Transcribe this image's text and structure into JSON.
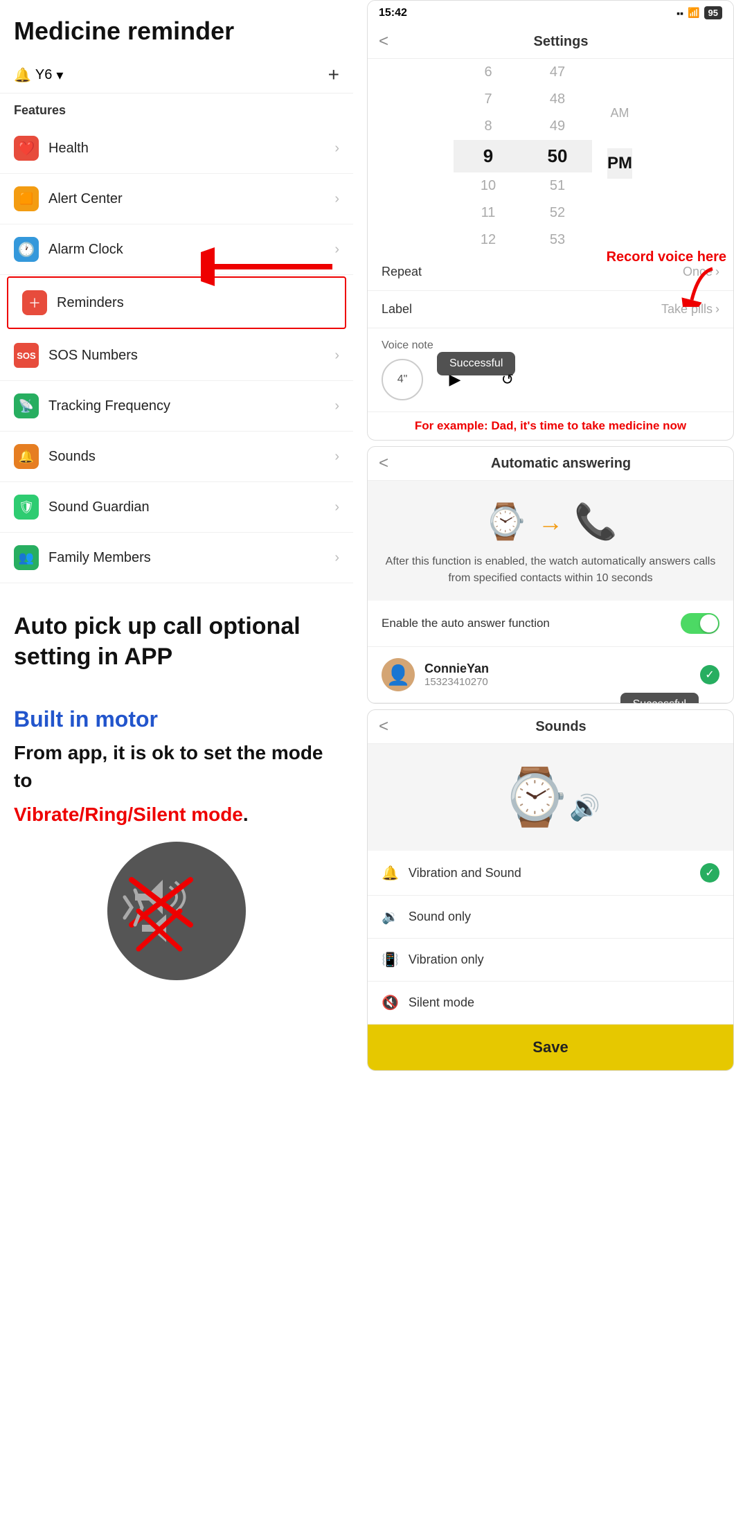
{
  "page": {
    "title": "Medicine reminder"
  },
  "left": {
    "device": {
      "name": "Y6",
      "dropdown_icon": "▾",
      "add_icon": "+"
    },
    "features_label": "Features",
    "menu_items": [
      {
        "id": "health",
        "icon": "❤️",
        "icon_class": "icon-red",
        "label": "Health"
      },
      {
        "id": "alert-center",
        "icon": "🟧",
        "icon_class": "icon-orange",
        "label": "Alert Center"
      },
      {
        "id": "alarm-clock",
        "icon": "🕐",
        "icon_class": "icon-blue",
        "label": "Alarm Clock"
      },
      {
        "id": "reminders",
        "icon": "🏥",
        "icon_class": "icon-red2",
        "label": "Reminders",
        "highlighted": true
      },
      {
        "id": "sos-numbers",
        "icon": "SOS",
        "icon_class": "icon-red-sos",
        "label": "SOS Numbers"
      },
      {
        "id": "tracking-frequency",
        "icon": "📡",
        "icon_class": "icon-green",
        "label": "Tracking Frequency"
      },
      {
        "id": "sounds",
        "icon": "🔊",
        "icon_class": "icon-orange2",
        "label": "Sounds"
      },
      {
        "id": "sound-guardian",
        "icon": "🛡",
        "icon_class": "icon-green2",
        "label": "Sound Guardian"
      },
      {
        "id": "family-members",
        "icon": "👥",
        "icon_class": "icon-green3",
        "label": "Family Members"
      }
    ],
    "auto_pickup": {
      "title": "Auto pick up call optional setting in APP"
    },
    "motor": {
      "title": "Built in motor",
      "desc1": "From app, it is ok to set the mode to",
      "highlight": "Vibrate/Ring/Silent mode",
      "highlight_end": "."
    }
  },
  "right": {
    "screen1": {
      "status_time": "15:42",
      "status_signal": "▪▪",
      "status_wifi": "wifi",
      "status_battery": "95",
      "nav_back": "<",
      "nav_title": "Settings",
      "time_picker": {
        "col1_values": [
          "6",
          "7",
          "8",
          "9",
          "10",
          "11",
          "12"
        ],
        "col2_values": [
          "47",
          "48",
          "49",
          "50",
          "51",
          "52",
          "53"
        ],
        "ampm_values": [
          "AM",
          "PM"
        ],
        "selected_h": "9",
        "selected_m": "50",
        "selected_ampm": "PM"
      },
      "rows": [
        {
          "label": "Repeat",
          "value": "Once"
        },
        {
          "label": "Label",
          "value": "Take pills"
        }
      ],
      "voice_note_label": "Voice note",
      "voice_duration": "4\"",
      "tooltip": "Successful",
      "annotation_record": "Record voice here",
      "annotation_example": "For example: Dad, it's time to take medicine now"
    },
    "screen2": {
      "nav_back": "<",
      "nav_title": "Automatic answering",
      "illustration_desc": "After this function is enabled, the watch automatically answers calls from specified contacts within 10 seconds",
      "toggle_label": "Enable the auto answer function",
      "contact_name": "ConnieYan",
      "contact_phone": "15323410270",
      "tooltip": "Successful"
    },
    "screen3": {
      "nav_back": "<",
      "nav_title": "Sounds",
      "options": [
        {
          "id": "vibration-sound",
          "label": "Vibration and Sound",
          "checked": true
        },
        {
          "id": "sound-only",
          "label": "Sound only",
          "checked": false
        },
        {
          "id": "vibration-only",
          "label": "Vibration only",
          "checked": false
        },
        {
          "id": "silent-mode",
          "label": "Silent mode",
          "checked": false
        }
      ],
      "save_label": "Save"
    }
  }
}
